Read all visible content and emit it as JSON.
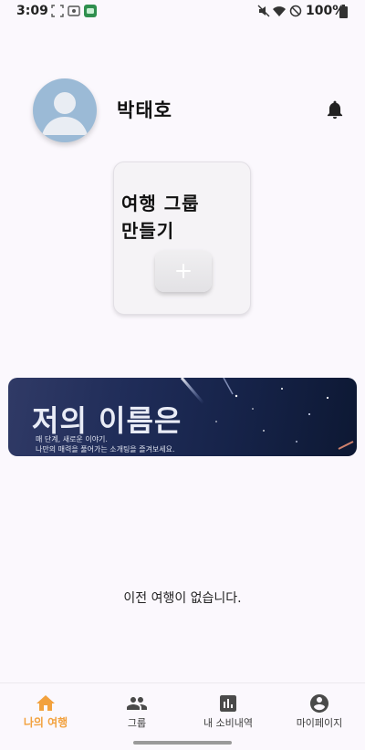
{
  "status_bar": {
    "time": "3:09",
    "battery_text": "100%"
  },
  "profile": {
    "name": "박태호"
  },
  "create_group": {
    "title": "여행 그룹 만들기"
  },
  "banner": {
    "title": "저의 이름은",
    "subtitle_line1": "매 단계, 새로운 이야기.",
    "subtitle_line2": "나만의 매력을 풀어가는 소개팅을 즐겨보세요."
  },
  "empty_message": "이전 여행이 없습니다.",
  "nav": {
    "items": [
      {
        "label": "나의 여행",
        "icon": "home-icon",
        "active": true
      },
      {
        "label": "그룹",
        "icon": "group-icon",
        "active": false
      },
      {
        "label": "내 소비내역",
        "icon": "bar-chart-icon",
        "active": false
      },
      {
        "label": "마이페이지",
        "icon": "account-icon",
        "active": false
      }
    ]
  },
  "colors": {
    "accent": "#f2a13d",
    "background": "#fbf8fd",
    "banner_dark": "#162349",
    "avatar": "#9bbad6"
  }
}
